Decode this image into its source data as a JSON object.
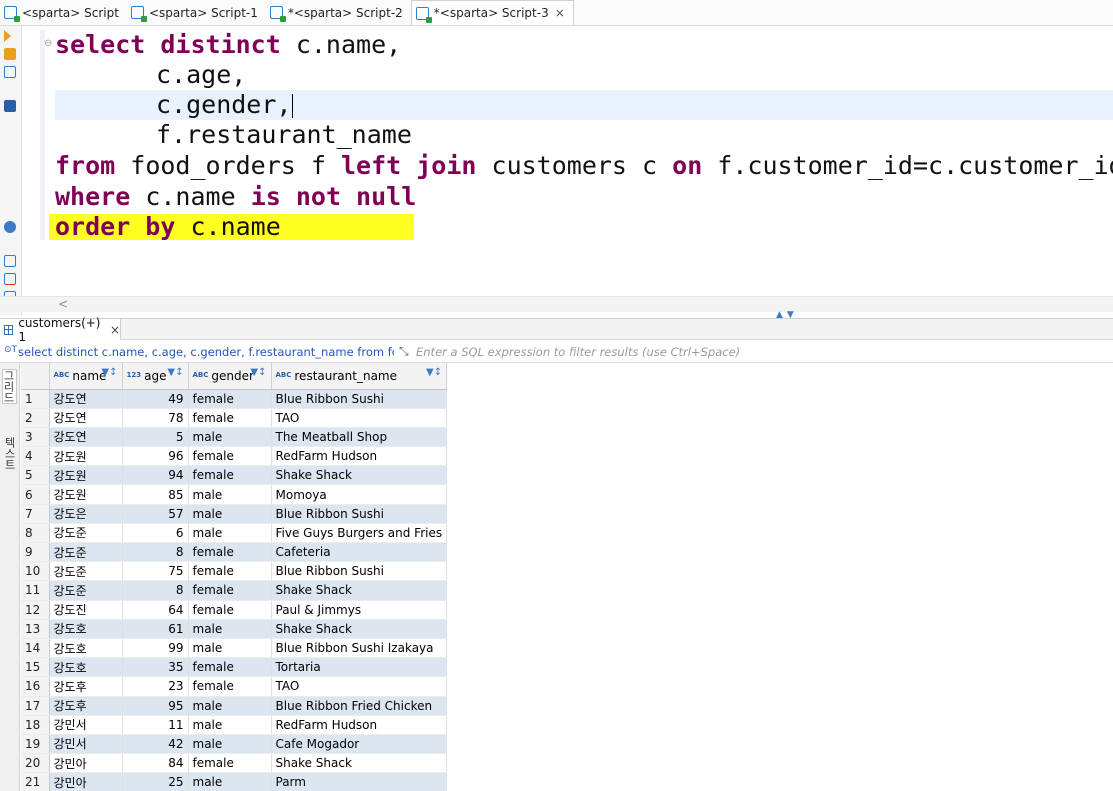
{
  "editor_tabs": [
    {
      "label": "<sparta> Script",
      "active": false
    },
    {
      "label": "<sparta> Script-1",
      "active": false
    },
    {
      "label": "*<sparta> Script-2",
      "active": false
    },
    {
      "label": "*<sparta> Script-3",
      "active": true
    }
  ],
  "editor_tab_close": "×",
  "code": {
    "l1_kw": "select distinct",
    "l1_rest": " c.name,",
    "l2": "c.age,",
    "l3": "c.gender,",
    "l4": "f.restaurant_name",
    "l5_kw1": "from",
    "l5_t1": " food_orders f ",
    "l5_kw2": "left join",
    "l5_t2": " customers c ",
    "l5_kw3": "on",
    "l5_t3": " f.customer_id=c.customer_id",
    "l6_kw1": "where",
    "l6_t1": " c.name ",
    "l6_kw2": "is not null",
    "l7_kw": "order by",
    "l7_t": " c.name"
  },
  "scroll_chevron": "<",
  "results_tab": {
    "label": "customers(+) 1",
    "close": "×"
  },
  "filter_bar": {
    "query_icon": "⊙T",
    "query": "select distinct c.name, c.age, c.gender, f.restaurant_name from food_o",
    "expand_icon": "⤡",
    "filter_placeholder": "Enter a SQL expression to filter results (use Ctrl+Space)"
  },
  "side_tabs": {
    "grid": "그리드",
    "text": "텍스트"
  },
  "columns": [
    {
      "type": "ABC",
      "label": "name"
    },
    {
      "type": "123",
      "label": "age"
    },
    {
      "type": "ABC",
      "label": "gender"
    },
    {
      "type": "ABC",
      "label": "restaurant_name"
    }
  ],
  "rows": [
    [
      "1",
      "강도연",
      "49",
      "female",
      "Blue Ribbon Sushi"
    ],
    [
      "2",
      "강도연",
      "78",
      "female",
      "TAO"
    ],
    [
      "3",
      "강도연",
      "5",
      "male",
      "The Meatball Shop"
    ],
    [
      "4",
      "강도원",
      "96",
      "female",
      "RedFarm Hudson"
    ],
    [
      "5",
      "강도원",
      "94",
      "female",
      "Shake Shack"
    ],
    [
      "6",
      "강도원",
      "85",
      "male",
      "Momoya"
    ],
    [
      "7",
      "강도은",
      "57",
      "male",
      "Blue Ribbon Sushi"
    ],
    [
      "8",
      "강도준",
      "6",
      "male",
      "Five Guys Burgers and Fries"
    ],
    [
      "9",
      "강도준",
      "8",
      "female",
      "Cafeteria"
    ],
    [
      "10",
      "강도준",
      "75",
      "female",
      "Blue Ribbon Sushi"
    ],
    [
      "11",
      "강도준",
      "8",
      "female",
      "Shake Shack"
    ],
    [
      "12",
      "강도진",
      "64",
      "female",
      "Paul & Jimmys"
    ],
    [
      "13",
      "강도호",
      "61",
      "male",
      "Shake Shack"
    ],
    [
      "14",
      "강도호",
      "99",
      "male",
      "Blue Ribbon Sushi Izakaya"
    ],
    [
      "15",
      "강도호",
      "35",
      "female",
      "Tortaria"
    ],
    [
      "16",
      "강도후",
      "23",
      "female",
      "TAO"
    ],
    [
      "17",
      "강도후",
      "95",
      "male",
      "Blue Ribbon Fried Chicken"
    ],
    [
      "18",
      "강민서",
      "11",
      "male",
      "RedFarm Hudson"
    ],
    [
      "19",
      "강민서",
      "42",
      "male",
      "Cafe Mogador"
    ],
    [
      "20",
      "강민아",
      "84",
      "female",
      "Shake Shack"
    ],
    [
      "21",
      "강민아",
      "25",
      "male",
      "Parm"
    ]
  ]
}
